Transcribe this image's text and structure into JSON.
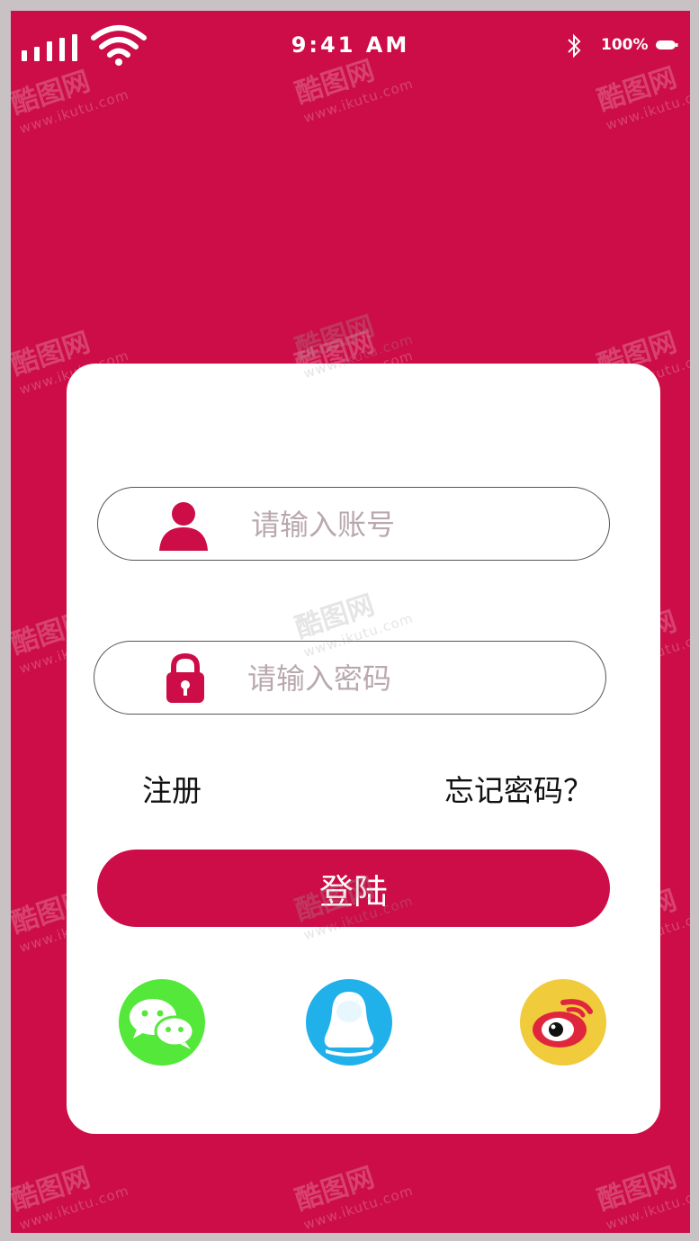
{
  "status_bar": {
    "time": "9:41 AM",
    "battery": "100%"
  },
  "login": {
    "account_placeholder": "请输入账号",
    "password_placeholder": "请输入密码",
    "register_label": "注册",
    "forgot_label": "忘记密码？",
    "login_label": "登陆"
  },
  "social_icons": [
    "wechat-icon",
    "qq-icon",
    "weibo-icon"
  ],
  "watermark": {
    "brand": "酷图网",
    "url": "www.ikutu.com"
  },
  "colors": {
    "primary": "#cc0d47",
    "wechat": "#54e83a",
    "qq": "#20b0ea",
    "weibo": "#f0cb3c"
  }
}
